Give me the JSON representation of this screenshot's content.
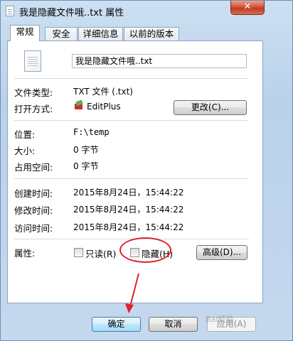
{
  "window": {
    "title": "我是隐藏文件哦..txt 属性",
    "close_label": "✕"
  },
  "tabs": [
    {
      "label": "常规"
    },
    {
      "label": "安全"
    },
    {
      "label": "详细信息"
    },
    {
      "label": "以前的版本"
    }
  ],
  "general": {
    "file_name": "我是隐藏文件哦..txt",
    "type_label": "文件类型:",
    "type_value": "TXT 文件 (.txt)",
    "open_label": "打开方式:",
    "open_app": "EditPlus",
    "change_button": "更改(C)...",
    "location_label": "位置:",
    "location_value": "F:\\temp",
    "size_label": "大小:",
    "size_value": "0 字节",
    "disk_label": "占用空间:",
    "disk_value": "0 字节",
    "created_label": "创建时间:",
    "created_value": "2015年8月24日，15:44:22",
    "modified_label": "修改时间:",
    "modified_value": "2015年8月24日，15:44:22",
    "accessed_label": "访问时间:",
    "accessed_value": "2015年8月24日，15:44:22",
    "attributes_label": "属性:",
    "readonly_label": "只读(R)",
    "hidden_label": "隐藏(H)",
    "advanced_button": "高级(D)..."
  },
  "footer": {
    "ok_button": "确定",
    "cancel_button": "取消",
    "apply_button": "应用(A)"
  },
  "watermark": "Bai经验"
}
